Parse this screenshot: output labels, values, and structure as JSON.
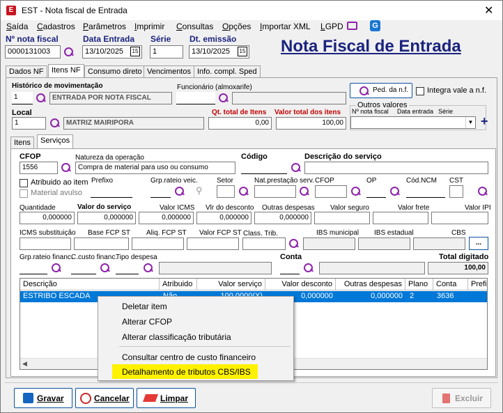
{
  "window": {
    "title": "EST - Nota fiscal de Entrada",
    "app_icon": "E"
  },
  "menu": [
    "Saída",
    "Cadastros",
    "Parâmetros",
    "Imprimir",
    "Consultas",
    "Opções",
    "Importar XML",
    "LGPD"
  ],
  "header": {
    "nota_label": "Nº nota fiscal",
    "nota_value": "0000131003",
    "data_entrada_label": "Data Entrada",
    "data_entrada_value": "13/10/2025",
    "serie_label": "Série",
    "serie_value": "1",
    "dt_emissao_label": "Dt. emissão",
    "dt_emissao_value": "13/10/2025",
    "cal_icon_text": "15",
    "big_title": "Nota Fiscal de Entrada"
  },
  "tabs": [
    "Dados NF",
    "Itens NF",
    "Consumo direto",
    "Vencimentos",
    "Info. compl. Sped"
  ],
  "itens_nf": {
    "historico_label": "Histórico de movimentação",
    "historico_code": "1",
    "historico_desc": "ENTRADA POR NOTA FISCAL",
    "funcionario_label": "Funcionário (almoxarife)",
    "funcionario_value": "",
    "ped_button": "Ped. da n.f.",
    "integra_label": "Integra vale a n.f.",
    "local_label": "Local",
    "local_code": "1",
    "local_desc": "MATRIZ MAIRIPORA",
    "qt_total_label": "Qt. total de Itens",
    "qt_total_value": "0,00",
    "valor_total_label": "Valor total dos itens",
    "valor_total_value": "100,00",
    "outros_valores_label": "Outros valores",
    "ov_cols": [
      "Nº nota fiscal",
      "Data entrada",
      "Série"
    ],
    "plus": "+"
  },
  "subtabs": [
    "Itens",
    "Serviços"
  ],
  "servicos": {
    "cfop_label": "CFOP",
    "cfop_value": "1556",
    "natureza_label": "Natureza da operação",
    "natureza_value": "Compra de material para uso ou consumo",
    "codigo_label": "Código",
    "codigo_value": "",
    "descricao_label": "Descrição do serviço",
    "descricao_value": "",
    "atribuido_label": "Atribuido ao item",
    "material_label": "Material avulso",
    "prefixo_label": "Prefixo",
    "grp_rateio_label": "Grp.rateio veic.",
    "setor_label": "Setor",
    "nat_prest_label": "Nat.prestação serv.",
    "cfop2_label": "CFOP",
    "op_label": "OP",
    "cod_ncm_label": "Cód.NCM",
    "cst_label": "CST",
    "quantidade_label": "Quantidade",
    "quantidade_value": "0,000000",
    "valor_servico_label": "Valor do serviço",
    "valor_servico_value": "0,000000",
    "valor_icms_label": "Valor ICMS",
    "valor_icms_value": "0,000000",
    "vlr_desconto_label": "Vlr do desconto",
    "vlr_desconto_value": "0,000000",
    "outras_desp_label": "Outras despesas",
    "outras_desp_value": "0,000000",
    "valor_seguro_label": "Valor seguro",
    "valor_frete_label": "Valor frete",
    "valor_ipi_label": "Valor IPI",
    "icms_sub_label": "ICMS substituição",
    "base_fcp_label": "Base FCP ST",
    "aliq_fcp_label": "Aliq. FCP ST",
    "valor_fcp_label": "Valor FCP ST",
    "class_trib_label": "Class. Trib.",
    "ibs_mun_label": "IBS municipal",
    "ibs_est_label": "IBS estadual",
    "cbs_label": "CBS",
    "cbs_button": "...",
    "grp_rateio_fin_label": "Grp.rateio financ.",
    "c_custo_label": "C.custo financ.",
    "tipo_despesa_label": "Tipo despesa",
    "conta_label": "Conta",
    "total_digitado_label": "Total digitado",
    "total_digitado_value": "100,00"
  },
  "grid": {
    "headers": [
      "Descrição",
      "Atribuido",
      "Valor serviço",
      "Valor desconto",
      "Outras despesas",
      "Plano",
      "Conta",
      "Prefixo"
    ],
    "row": [
      "ESTRIBO ESCADA",
      "Não",
      "100,0000(X)",
      "0,000000",
      "0,000000",
      "2",
      "3636",
      ""
    ]
  },
  "context_menu": [
    "Deletar item",
    "Alterar CFOP",
    "Alterar classificação tributária",
    "Consultar centro de custo financeiro",
    "Detalhamento de tributos CBS/IBS"
  ],
  "buttons": {
    "gravar": "Gravar",
    "cancelar": "Cancelar",
    "limpar": "Limpar",
    "excluir": "Excluir"
  },
  "colors": {
    "accent": "#1a237e",
    "selection": "#0078d7",
    "highlight": "#fff200",
    "required": "#c00000"
  }
}
